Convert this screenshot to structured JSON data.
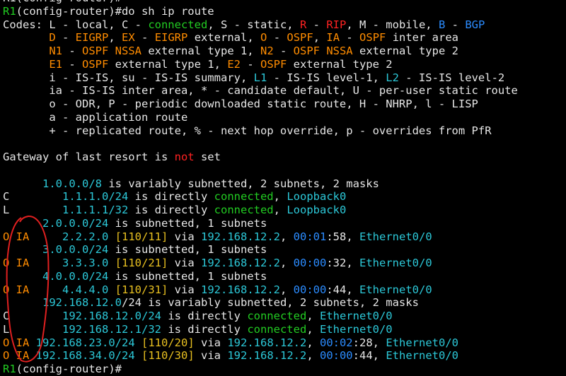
{
  "colors": {
    "default": "#e6e6e6",
    "green": "#22cc22",
    "red": "#ff2222",
    "blue": "#2b8cff",
    "orange": "#ff8c00",
    "yellow": "#e8c020",
    "cyan": "#2cc8d8",
    "annotation": "#e02020",
    "background": "#000000"
  },
  "terminal": {
    "lines": [
      [
        [
          "w",
          "R1(config-router)#"
        ]
      ],
      [
        [
          "g",
          "R1"
        ],
        [
          "w",
          "(config-router)#do sh ip route"
        ]
      ],
      [
        [
          "w",
          "Codes: L - local, C - "
        ],
        [
          "g",
          "connected"
        ],
        [
          "w",
          ", S - static, "
        ],
        [
          "r",
          "R"
        ],
        [
          "w",
          " - "
        ],
        [
          "r",
          "RIP"
        ],
        [
          "w",
          ", M - mobile, "
        ],
        [
          "b",
          "B"
        ],
        [
          "w",
          " - "
        ],
        [
          "b",
          "BGP"
        ]
      ],
      [
        [
          "w",
          "       "
        ],
        [
          "o",
          "D"
        ],
        [
          "w",
          " - "
        ],
        [
          "o",
          "EIGRP"
        ],
        [
          "w",
          ", "
        ],
        [
          "o",
          "EX"
        ],
        [
          "w",
          " - "
        ],
        [
          "o",
          "EIGRP"
        ],
        [
          "w",
          " external, "
        ],
        [
          "o",
          "O"
        ],
        [
          "w",
          " - "
        ],
        [
          "o",
          "OSPF"
        ],
        [
          "w",
          ", "
        ],
        [
          "o",
          "IA"
        ],
        [
          "w",
          " - "
        ],
        [
          "o",
          "OSPF"
        ],
        [
          "w",
          " inter area"
        ]
      ],
      [
        [
          "w",
          "       "
        ],
        [
          "o",
          "N1"
        ],
        [
          "w",
          " - "
        ],
        [
          "o",
          "OSPF NSSA"
        ],
        [
          "w",
          " external type 1, "
        ],
        [
          "o",
          "N2"
        ],
        [
          "w",
          " - "
        ],
        [
          "o",
          "OSPF NSSA"
        ],
        [
          "w",
          " external type 2"
        ]
      ],
      [
        [
          "w",
          "       "
        ],
        [
          "o",
          "E1"
        ],
        [
          "w",
          " - "
        ],
        [
          "o",
          "OSPF"
        ],
        [
          "w",
          " external type 1, "
        ],
        [
          "o",
          "E2"
        ],
        [
          "w",
          " - "
        ],
        [
          "o",
          "OSPF"
        ],
        [
          "w",
          " external type 2"
        ]
      ],
      [
        [
          "w",
          "       i - IS-IS, su - IS-IS summary, "
        ],
        [
          "c",
          "L1"
        ],
        [
          "w",
          " - IS-IS level-1, "
        ],
        [
          "c",
          "L2"
        ],
        [
          "w",
          " - IS-IS level-2"
        ]
      ],
      [
        [
          "w",
          "       ia - IS-IS inter area, * - candidate default, U - per-user static route"
        ]
      ],
      [
        [
          "w",
          "       o - ODR, P - periodic downloaded static route, H - NHRP, l - LISP"
        ]
      ],
      [
        [
          "w",
          "       a - application route"
        ]
      ],
      [
        [
          "w",
          "       + - replicated route, % - next hop override, p - overrides from PfR"
        ]
      ],
      [
        [
          "w",
          ""
        ]
      ],
      [
        [
          "w",
          "Gateway of last resort is "
        ],
        [
          "r",
          "not"
        ],
        [
          "w",
          " set"
        ]
      ],
      [
        [
          "w",
          ""
        ]
      ],
      [
        [
          "w",
          "      "
        ],
        [
          "c",
          "1.0.0.0/8"
        ],
        [
          "w",
          " is variably subnetted, 2 subnets, 2 masks"
        ]
      ],
      [
        [
          "w",
          "C        "
        ],
        [
          "c",
          "1.1.1.0/24"
        ],
        [
          "w",
          " is directly "
        ],
        [
          "g",
          "connected"
        ],
        [
          "w",
          ", "
        ],
        [
          "c",
          "Loopback0"
        ]
      ],
      [
        [
          "w",
          "L        "
        ],
        [
          "c",
          "1.1.1.1/32"
        ],
        [
          "w",
          " is directly "
        ],
        [
          "g",
          "connected"
        ],
        [
          "w",
          ", "
        ],
        [
          "c",
          "Loopback0"
        ]
      ],
      [
        [
          "w",
          "      "
        ],
        [
          "c",
          "2.0.0.0/24"
        ],
        [
          "w",
          " is subnetted, 1 subnets"
        ]
      ],
      [
        [
          "o",
          "O IA"
        ],
        [
          "w",
          "     "
        ],
        [
          "c",
          "2.2.2.0"
        ],
        [
          "w",
          " "
        ],
        [
          "y",
          "[110/11]"
        ],
        [
          "w",
          " via "
        ],
        [
          "c",
          "192.168.12.2"
        ],
        [
          "w",
          ", "
        ],
        [
          "b",
          "00:01"
        ],
        [
          "w",
          ":58, "
        ],
        [
          "c",
          "Ethernet0/0"
        ]
      ],
      [
        [
          "w",
          "      "
        ],
        [
          "c",
          "3.0.0.0/24"
        ],
        [
          "w",
          " is subnetted, 1 subnets"
        ]
      ],
      [
        [
          "o",
          "O IA"
        ],
        [
          "w",
          "     "
        ],
        [
          "c",
          "3.3.3.0"
        ],
        [
          "w",
          " "
        ],
        [
          "y",
          "[110/21]"
        ],
        [
          "w",
          " via "
        ],
        [
          "c",
          "192.168.12.2"
        ],
        [
          "w",
          ", "
        ],
        [
          "b",
          "00:00"
        ],
        [
          "w",
          ":32, "
        ],
        [
          "c",
          "Ethernet0/0"
        ]
      ],
      [
        [
          "w",
          "      "
        ],
        [
          "c",
          "4.0.0.0/24"
        ],
        [
          "w",
          " is subnetted, 1 subnets"
        ]
      ],
      [
        [
          "o",
          "O IA"
        ],
        [
          "w",
          "     "
        ],
        [
          "c",
          "4.4.4.0"
        ],
        [
          "w",
          " "
        ],
        [
          "y",
          "[110/31]"
        ],
        [
          "w",
          " via "
        ],
        [
          "c",
          "192.168.12.2"
        ],
        [
          "w",
          ", "
        ],
        [
          "b",
          "00:00"
        ],
        [
          "w",
          ":44, "
        ],
        [
          "c",
          "Ethernet0/0"
        ]
      ],
      [
        [
          "w",
          "      "
        ],
        [
          "c",
          "192.168.12.0"
        ],
        [
          "w",
          "/24 is variably subnetted, 2 subnets, 2 masks"
        ]
      ],
      [
        [
          "w",
          "C        "
        ],
        [
          "c",
          "192.168.12.0/24"
        ],
        [
          "w",
          " is directly "
        ],
        [
          "g",
          "connected"
        ],
        [
          "w",
          ", "
        ],
        [
          "c",
          "Ethernet0/0"
        ]
      ],
      [
        [
          "w",
          "L        "
        ],
        [
          "c",
          "192.168.12.1/32"
        ],
        [
          "w",
          " is directly "
        ],
        [
          "g",
          "connected"
        ],
        [
          "w",
          ", "
        ],
        [
          "c",
          "Ethernet0/0"
        ]
      ],
      [
        [
          "o",
          "O IA"
        ],
        [
          "w",
          " "
        ],
        [
          "c",
          "192.168.23.0/24"
        ],
        [
          "w",
          " "
        ],
        [
          "y",
          "[110/20]"
        ],
        [
          "w",
          " via "
        ],
        [
          "c",
          "192.168.12.2"
        ],
        [
          "w",
          ", "
        ],
        [
          "b",
          "00:02"
        ],
        [
          "w",
          ":28, "
        ],
        [
          "c",
          "Ethernet0/0"
        ]
      ],
      [
        [
          "o",
          "O IA"
        ],
        [
          "w",
          " "
        ],
        [
          "c",
          "192.168.34.0/24"
        ],
        [
          "w",
          " "
        ],
        [
          "y",
          "[110/30]"
        ],
        [
          "w",
          " via "
        ],
        [
          "c",
          "192.168.12.2"
        ],
        [
          "w",
          ", "
        ],
        [
          "b",
          "00:00"
        ],
        [
          "w",
          ":44, "
        ],
        [
          "c",
          "Ethernet0/0"
        ]
      ],
      [
        [
          "g",
          "R1"
        ],
        [
          "w",
          "(config-router)#"
        ]
      ]
    ]
  }
}
